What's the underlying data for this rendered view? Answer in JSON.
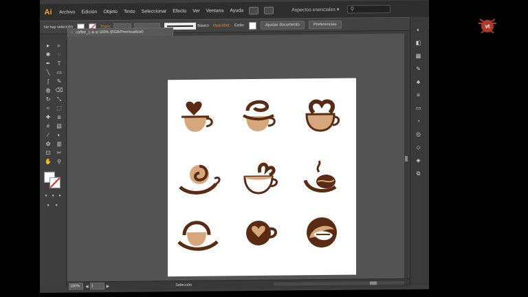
{
  "app": {
    "logo": "Ai",
    "workspace": "Aspectos esenciales ▾",
    "search_placeholder": "⚲"
  },
  "menu": [
    "Archivo",
    "Edición",
    "Objeto",
    "Texto",
    "Seleccionar",
    "Efecto",
    "Ver",
    "Ventana",
    "Ayuda"
  ],
  "control_bar": {
    "selection_label": "No hay selección",
    "stroke_label": "Trazo:",
    "style_label": "Básico",
    "opacity_label": "Opacidad:",
    "style_field_label": "Estilo:",
    "document_button": "Ajustar documento",
    "preferences_button": "Preferencias"
  },
  "document_tab": {
    "close": "×",
    "title": "coffee_1.ai al 100% (RGB/Previsualizar)"
  },
  "status_bar": {
    "zoom": "100%",
    "page": "1",
    "tool": "Selección"
  },
  "watermark": {
    "text": "vt"
  },
  "colors": {
    "coffee": "#5a2a12",
    "latte": "#d6a77a",
    "accent": "#f7a21b",
    "watermark": "#b0392b"
  },
  "icons": {
    "tools": [
      "selection-icon",
      "direct-selection-icon",
      "magic-wand-icon",
      "lasso-icon",
      "pen-icon",
      "type-icon",
      "line-icon",
      "rectangle-icon",
      "paintbrush-icon",
      "pencil-icon",
      "blob-brush-icon",
      "eraser-icon",
      "rotate-icon",
      "scale-icon",
      "width-icon",
      "free-transform-icon",
      "shape-builder-icon",
      "perspective-icon",
      "mesh-icon",
      "gradient-icon",
      "eyedropper-icon",
      "blend-icon",
      "symbol-sprayer-icon",
      "graph-icon",
      "artboard-icon",
      "slice-icon",
      "hand-icon",
      "zoom-icon"
    ],
    "dock": [
      "color-icon",
      "color-guide-icon",
      "swatches-icon",
      "brushes-icon",
      "symbols-icon",
      "stroke-icon",
      "gradient-panel-icon",
      "transparency-icon",
      "appearance-icon",
      "graphic-styles-icon",
      "layers-icon",
      "artboards-icon"
    ]
  }
}
